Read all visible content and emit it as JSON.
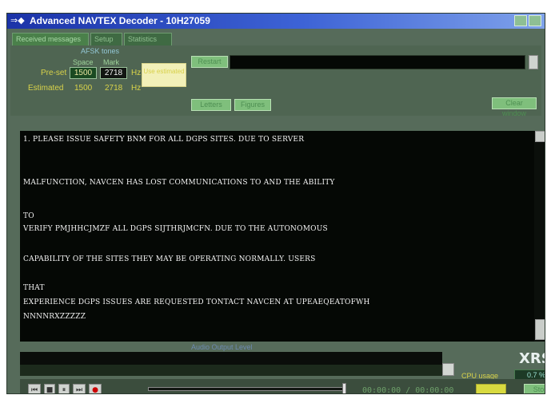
{
  "window": {
    "title": "Advanced NAVTEX Decoder - 10H27059",
    "title_icon": "⇒◆"
  },
  "tabs": [
    {
      "label": "Received messages",
      "active": true
    },
    {
      "label": "Setup",
      "active": false
    },
    {
      "label": "Statistics",
      "active": false
    }
  ],
  "afsk": {
    "title": "AFSK tones",
    "space_label": "Space",
    "mark_label": "Mark",
    "preset_label": "Pre-set",
    "preset_space": "1500",
    "preset_mark": "2718",
    "estimated_label": "Estimated",
    "estimated_space": "1500",
    "estimated_mark": "2718",
    "hz": "Hz",
    "use_button": "Use estimated"
  },
  "buttons": {
    "top_btn": "Restart",
    "letters": "Letters",
    "figures": "Figures",
    "right_btn": "Clear window"
  },
  "message_lines": [
    "1. PLEASE ISSUE SAFETY BNM FOR ALL DGPS SITES. DUE TO SERVER",
    "MALFUNCTION, NAVCEN HAS LOST COMMUNICATIONS TO AND THE ABILITY",
    "TO",
    "VERIFY PMJHHCJMZF ALL DGPS SIJTHRJMCFN. DUE TO THE AUTONOMOUS",
    "CAPABILITY OF THE SITES THEY MAY BE OPERATING NORMALLY. USERS",
    "THAT",
    "EXPERIENCE DGPS ISSUES ARE REQUESTED TONTACT NAVCEN AT UPEAEQEATOFWH",
    "NNNNRXZZZZZ"
  ],
  "status": {
    "label": "Audio Output Level"
  },
  "brand": {
    "text": "XRS"
  },
  "cpu": {
    "label": "CPU usage",
    "value": "0.7 %"
  },
  "playback": {
    "timecode": "00:00:00 / 00:00:00",
    "controls": [
      "⏮",
      "■",
      "⏸",
      "⏭",
      "●"
    ],
    "end_btn": "Stop"
  },
  "colors": {
    "accent_green": "#7fbf7c",
    "text_yellow": "#d8d24a",
    "record_red": "#cc0000"
  }
}
